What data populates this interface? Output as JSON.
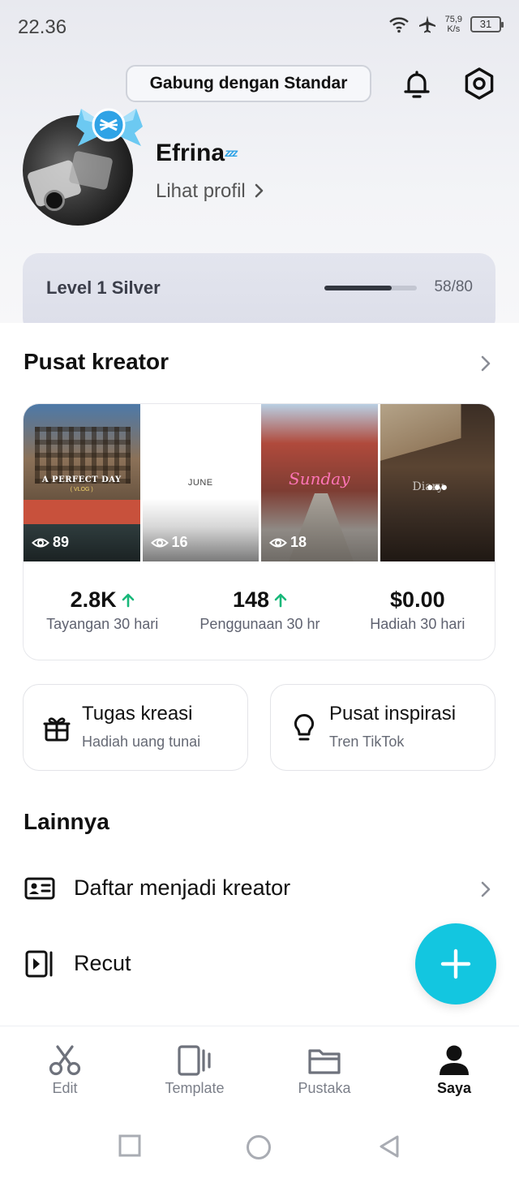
{
  "status_bar": {
    "time": "22.36",
    "speed_value": "75,9",
    "speed_unit": "K/s",
    "battery": "31"
  },
  "header": {
    "join_button": "Gabung dengan Standar",
    "bell_icon": "bell-icon",
    "settings_icon": "gear-icon"
  },
  "profile": {
    "name": "Efrina",
    "name_emoji": "ᶻᶻᶻ",
    "view_profile": "Lihat profil"
  },
  "level": {
    "name": "Level 1 Silver",
    "count": "58/80",
    "progress": 0.725
  },
  "creator_center": {
    "title": "Pusat kreator",
    "thumbnails": [
      {
        "views": "89",
        "title": "A PERFECT DAY",
        "subtitle": "( VLOG )"
      },
      {
        "views": "16",
        "title": "JUNE"
      },
      {
        "views": "18",
        "title": "Sunday"
      },
      {
        "views": "",
        "title": "Diary"
      }
    ],
    "stats": [
      {
        "value": "2.8K",
        "label": "Tayangan 30 hari",
        "trend": "up"
      },
      {
        "value": "148",
        "label": "Penggunaan 30 hr",
        "trend": "up"
      },
      {
        "value": "$0.00",
        "label": "Hadiah 30 hari",
        "trend": "none"
      }
    ]
  },
  "features": [
    {
      "title": "Tugas kreasi",
      "subtitle": "Hadiah uang tunai",
      "icon": "gift-icon"
    },
    {
      "title": "Pusat inspirasi",
      "subtitle": "Tren TikTok",
      "icon": "lightbulb-icon"
    }
  ],
  "others": {
    "title": "Lainnya",
    "items": [
      {
        "label": "Daftar menjadi kreator",
        "icon": "id-card-icon"
      },
      {
        "label": "Recut",
        "icon": "recut-icon"
      }
    ]
  },
  "bottom_nav": [
    {
      "label": "Edit",
      "icon": "scissors-icon",
      "active": false
    },
    {
      "label": "Template",
      "icon": "template-icon",
      "active": false
    },
    {
      "label": "Pustaka",
      "icon": "folder-icon",
      "active": false
    },
    {
      "label": "Saya",
      "icon": "person-icon",
      "active": true
    }
  ],
  "colors": {
    "accent": "#13c6e0",
    "trend_up": "#18b87a",
    "brand_badge": "#2fa3e6"
  }
}
